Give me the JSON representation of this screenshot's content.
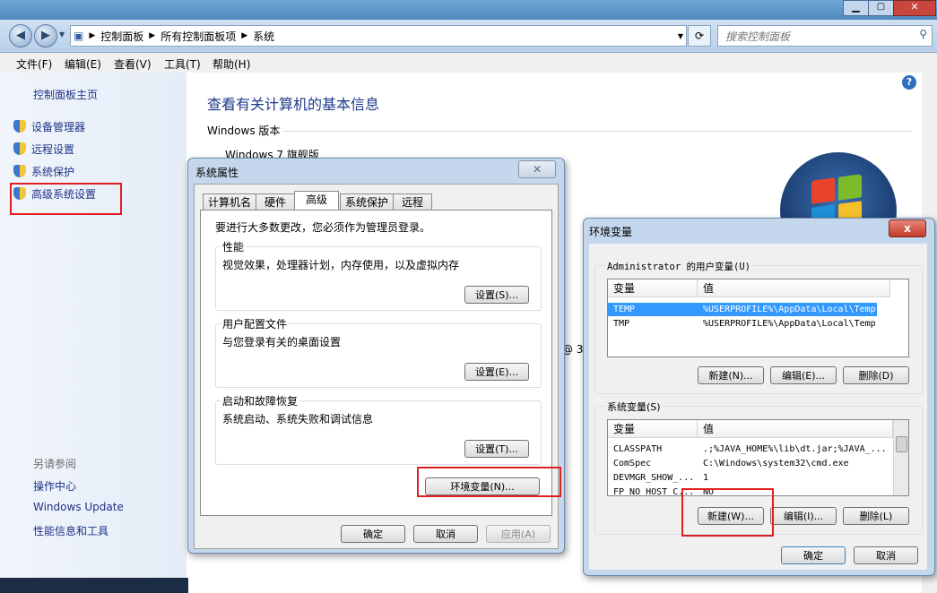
{
  "explorer": {
    "breadcrumb": [
      "控制面板",
      "所有控制面板项",
      "系统"
    ],
    "search_placeholder": "搜索控制面板",
    "menu": [
      "文件(F)",
      "编辑(E)",
      "查看(V)",
      "工具(T)",
      "帮助(H)"
    ],
    "sidebar": {
      "home": "控制面板主页",
      "links": [
        "设备管理器",
        "远程设置",
        "系统保护",
        "高级系统设置"
      ],
      "see_also_title": "另请参阅",
      "see_also": [
        "操作中心",
        "Windows Update",
        "性能信息和工具"
      ]
    },
    "main": {
      "title": "查看有关计算机的基本信息",
      "edition_heading": "Windows 版本",
      "edition": "Windows 7 旗舰版",
      "partial_text": "@ 3"
    }
  },
  "sysprops": {
    "title": "系统属性",
    "tabs": [
      "计算机名",
      "硬件",
      "高级",
      "系统保护",
      "远程"
    ],
    "active_tab": 2,
    "admin_note": "要进行大多数更改，您必须作为管理员登录。",
    "groups": [
      {
        "label": "性能",
        "desc": "视觉效果，处理器计划，内存使用，以及虚拟内存",
        "button": "设置(S)..."
      },
      {
        "label": "用户配置文件",
        "desc": "与您登录有关的桌面设置",
        "button": "设置(E)..."
      },
      {
        "label": "启动和故障恢复",
        "desc": "系统启动、系统失败和调试信息",
        "button": "设置(T)..."
      }
    ],
    "env_button": "环境变量(N)...",
    "ok": "确定",
    "cancel": "取消",
    "apply": "应用(A)"
  },
  "envvars": {
    "title": "环境变量",
    "close": "x",
    "user_group": "Administrator 的用户变量(U)",
    "system_group": "系统变量(S)",
    "col_var": "变量",
    "col_val": "值",
    "user_vars": [
      {
        "name": "TEMP",
        "value": "%USERPROFILE%\\AppData\\Local\\Temp",
        "selected": true
      },
      {
        "name": "TMP",
        "value": "%USERPROFILE%\\AppData\\Local\\Temp",
        "selected": false
      }
    ],
    "system_vars": [
      {
        "name": "CLASSPATH",
        "value": ".;%JAVA_HOME%\\lib\\dt.jar;%JAVA_..."
      },
      {
        "name": "ComSpec",
        "value": "C:\\Windows\\system32\\cmd.exe"
      },
      {
        "name": "DEVMGR_SHOW_...",
        "value": "1"
      },
      {
        "name": "FP_NO_HOST_C...",
        "value": "NO"
      }
    ],
    "user_buttons": [
      "新建(N)...",
      "编辑(E)...",
      "删除(D)"
    ],
    "system_buttons": [
      "新建(W)...",
      "编辑(I)...",
      "删除(L)"
    ],
    "ok": "确定",
    "cancel": "取消"
  }
}
